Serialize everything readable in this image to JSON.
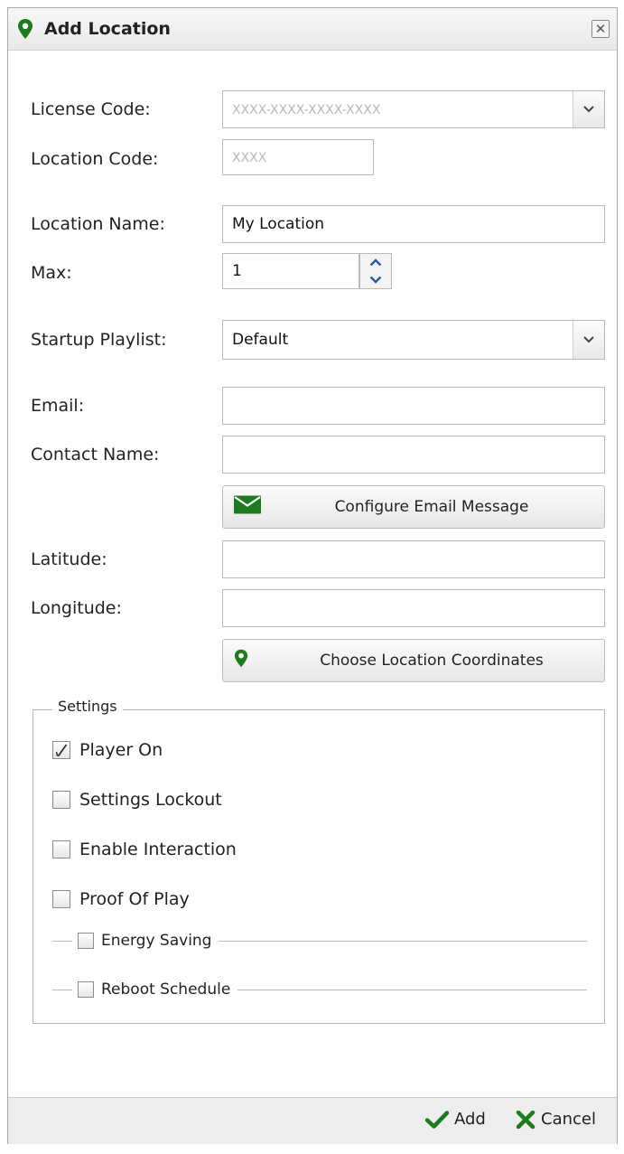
{
  "dialog": {
    "title": "Add Location",
    "title_icon": "map-pin-icon",
    "close_label": "✕"
  },
  "form": {
    "license_code": {
      "label": "License Code:",
      "placeholder": "XXXX-XXXX-XXXX-XXXX",
      "value": ""
    },
    "location_code": {
      "label": "Location Code:",
      "placeholder": "XXXX",
      "value": ""
    },
    "location_name": {
      "label": "Location Name:",
      "value": "My Location"
    },
    "max": {
      "label": "Max:",
      "value": "1"
    },
    "startup_playlist": {
      "label": "Startup Playlist:",
      "value": "Default"
    },
    "email": {
      "label": "Email:",
      "value": ""
    },
    "contact_name": {
      "label": "Contact Name:",
      "value": ""
    },
    "configure_email_button": {
      "label": "Configure Email Message",
      "icon": "envelope-icon"
    },
    "latitude": {
      "label": "Latitude:",
      "value": ""
    },
    "longitude": {
      "label": "Longitude:",
      "value": ""
    },
    "choose_coordinates_button": {
      "label": "Choose Location Coordinates",
      "icon": "map-pin-icon"
    }
  },
  "settings": {
    "legend": "Settings",
    "options": [
      {
        "label": "Player On",
        "checked": true
      },
      {
        "label": "Settings Lockout",
        "checked": false
      },
      {
        "label": "Enable Interaction",
        "checked": false
      },
      {
        "label": "Proof Of Play",
        "checked": false
      }
    ],
    "subsections": [
      {
        "label": "Energy Saving",
        "checked": false
      },
      {
        "label": "Reboot Schedule",
        "checked": false
      }
    ]
  },
  "footer": {
    "add_label": "Add",
    "cancel_label": "Cancel"
  },
  "colors": {
    "accent_green": "#1e7a1e",
    "border": "#b9b9b9",
    "footer_bg": "#ededed"
  }
}
